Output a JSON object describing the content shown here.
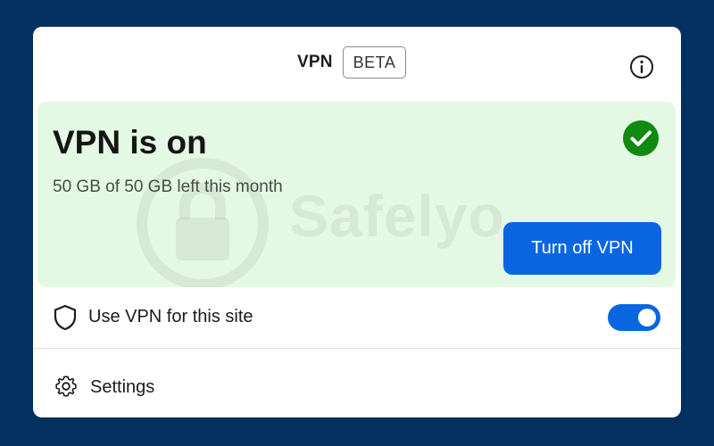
{
  "header": {
    "title": "VPN",
    "badge": "BETA",
    "info_icon": "info-icon"
  },
  "status": {
    "heading": "VPN is on",
    "data_remaining": "50 GB of 50 GB left this month",
    "status_icon": "check-circle-icon",
    "button_label": "Turn off VPN"
  },
  "site": {
    "icon": "shield-icon",
    "label": "Use VPN for this site",
    "toggle_on": true
  },
  "settings": {
    "icon": "gear-icon",
    "label": "Settings"
  },
  "watermark": {
    "text": "Safelyo"
  },
  "colors": {
    "background": "#04305f",
    "panel": "#ffffff",
    "status_card": "#e3f9e3",
    "accent_blue": "#0a66e0",
    "check_green": "#108a10"
  }
}
